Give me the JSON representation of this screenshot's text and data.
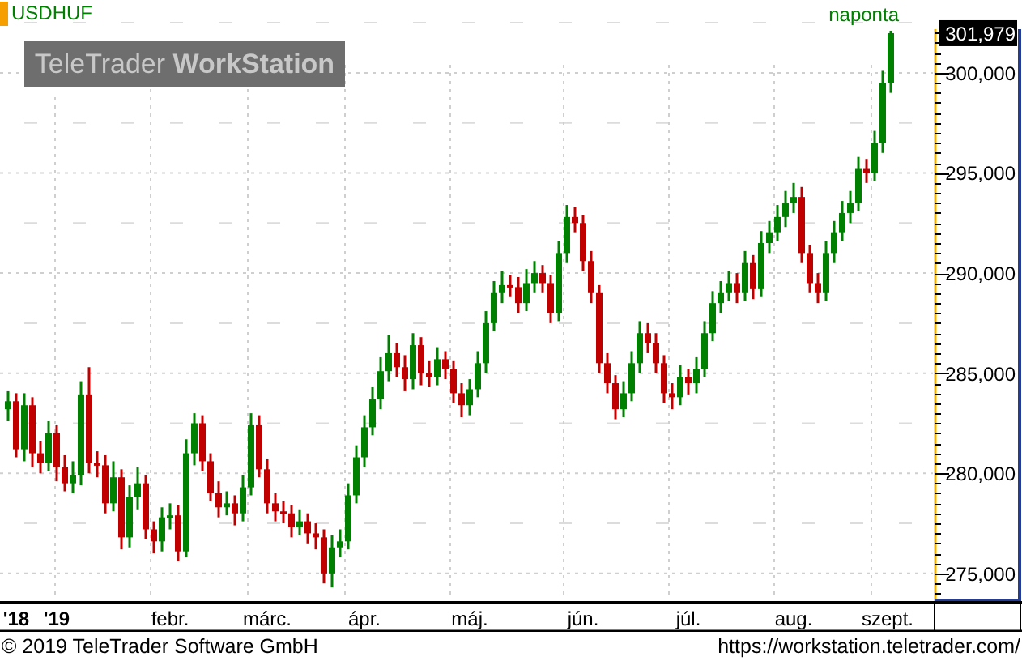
{
  "instrument": {
    "interval": "naponta"
  },
  "branding": {
    "logo": "TeleTrader **WorkStation**"
  },
  "chart": {
    "last_price": "301,979",
    "year_labels": [
      "'18",
      "'19"
    ],
    "chart_data": {
      "type": "candlestick",
      "title": "USDHUF",
      "ylim": [
        273700,
        302180
      ],
      "grid": true,
      "categories": [
        null,
        null,
        null,
        null,
        null,
        null,
        null,
        null,
        null,
        null,
        null,
        null,
        null,
        null,
        null,
        null,
        null,
        null,
        null,
        null,
        "febr.",
        null,
        null,
        null,
        null,
        null,
        null,
        null,
        null,
        null,
        null,
        null,
        "márc.",
        null,
        null,
        null,
        null,
        null,
        null,
        null,
        null,
        null,
        null,
        null,
        "ápr.",
        null,
        null,
        null,
        null,
        null,
        null,
        null,
        null,
        null,
        null,
        null,
        null,
        "máj.",
        null,
        null,
        null,
        null,
        null,
        null,
        null,
        null,
        null,
        null,
        null,
        null,
        null,
        "jún.",
        null,
        null,
        null,
        null,
        null,
        null,
        null,
        null,
        null,
        null,
        null,
        null,
        "júl.",
        null,
        null,
        null,
        null,
        null,
        null,
        null,
        null,
        null,
        null,
        null,
        null,
        "aug.",
        null,
        null,
        null,
        null,
        null,
        null,
        null,
        null,
        null,
        null,
        null,
        "szept."
      ],
      "ohlc": [
        [
          283200,
          284100,
          282600,
          283600
        ],
        [
          283600,
          284000,
          280800,
          281200
        ],
        [
          281200,
          284000,
          280600,
          283400
        ],
        [
          283400,
          283800,
          280300,
          281000
        ],
        [
          281000,
          281600,
          280000,
          280500
        ],
        [
          280500,
          282600,
          280100,
          282000
        ],
        [
          282000,
          282400,
          279600,
          280300
        ],
        [
          280300,
          280900,
          279100,
          279500
        ],
        [
          279500,
          280600,
          279000,
          279900
        ],
        [
          279900,
          284600,
          279400,
          283900
        ],
        [
          283900,
          285300,
          280000,
          280500
        ],
        [
          280500,
          281100,
          279800,
          280400
        ],
        [
          280400,
          280900,
          278000,
          278500
        ],
        [
          278500,
          280600,
          278100,
          279800
        ],
        [
          279800,
          280200,
          276200,
          276800
        ],
        [
          276800,
          279400,
          276300,
          278800
        ],
        [
          278800,
          280300,
          278200,
          279500
        ],
        [
          279500,
          279900,
          276700,
          277200
        ],
        [
          277200,
          277600,
          276000,
          276600
        ],
        [
          276600,
          278300,
          276100,
          277800
        ],
        [
          277800,
          278500,
          277200,
          277900
        ],
        [
          277900,
          278400,
          275600,
          276100
        ],
        [
          276100,
          281700,
          275800,
          281000
        ],
        [
          281000,
          283000,
          280400,
          282500
        ],
        [
          282500,
          282900,
          280100,
          280600
        ],
        [
          280600,
          281000,
          278600,
          279000
        ],
        [
          279000,
          279600,
          277800,
          278300
        ],
        [
          278300,
          279100,
          277900,
          278500
        ],
        [
          278500,
          278900,
          277400,
          278000
        ],
        [
          278000,
          279900,
          277600,
          279300
        ],
        [
          279300,
          283000,
          278900,
          282400
        ],
        [
          282400,
          282900,
          279800,
          280200
        ],
        [
          280200,
          280700,
          278000,
          278500
        ],
        [
          278500,
          279000,
          277600,
          278100
        ],
        [
          278100,
          278600,
          277500,
          278000
        ],
        [
          278000,
          278400,
          276800,
          277300
        ],
        [
          277300,
          278200,
          276900,
          277600
        ],
        [
          277600,
          278000,
          276500,
          277000
        ],
        [
          277000,
          277500,
          276200,
          276800
        ],
        [
          276800,
          277200,
          274500,
          275000
        ],
        [
          275000,
          276900,
          274300,
          276300
        ],
        [
          276300,
          277200,
          275800,
          276600
        ],
        [
          276600,
          279500,
          276200,
          278900
        ],
        [
          278900,
          281400,
          278500,
          280800
        ],
        [
          280800,
          282900,
          280300,
          282300
        ],
        [
          282300,
          284300,
          281900,
          283700
        ],
        [
          283700,
          285800,
          283200,
          285100
        ],
        [
          285100,
          286900,
          284600,
          286000
        ],
        [
          286000,
          286500,
          284800,
          285300
        ],
        [
          285300,
          285900,
          284100,
          284700
        ],
        [
          284700,
          287000,
          284200,
          286400
        ],
        [
          286400,
          286800,
          284400,
          285000
        ],
        [
          285000,
          285600,
          284300,
          284800
        ],
        [
          284800,
          286300,
          284400,
          285700
        ],
        [
          285700,
          286100,
          284700,
          285200
        ],
        [
          285200,
          285600,
          283500,
          284000
        ],
        [
          284000,
          284500,
          282800,
          283400
        ],
        [
          283400,
          284700,
          282900,
          284200
        ],
        [
          284200,
          286100,
          283800,
          285500
        ],
        [
          285500,
          288100,
          285000,
          287500
        ],
        [
          287500,
          289600,
          287100,
          289000
        ],
        [
          289000,
          290100,
          288500,
          289400
        ],
        [
          289400,
          289900,
          288800,
          289300
        ],
        [
          289300,
          289800,
          288000,
          288500
        ],
        [
          288500,
          290200,
          288100,
          289500
        ],
        [
          289500,
          290600,
          289000,
          290000
        ],
        [
          290000,
          290400,
          289000,
          289500
        ],
        [
          289500,
          289900,
          287500,
          288000
        ],
        [
          288000,
          291600,
          287600,
          291000
        ],
        [
          291000,
          293400,
          290500,
          292800
        ],
        [
          292800,
          293300,
          292000,
          292500
        ],
        [
          292500,
          292900,
          290100,
          290600
        ],
        [
          290600,
          291100,
          288500,
          289000
        ],
        [
          289000,
          289400,
          285000,
          285500
        ],
        [
          285500,
          286000,
          284000,
          284500
        ],
        [
          284500,
          284900,
          282700,
          283200
        ],
        [
          283200,
          284600,
          282800,
          284000
        ],
        [
          284000,
          286100,
          283600,
          285500
        ],
        [
          285500,
          287600,
          285000,
          287000
        ],
        [
          287000,
          287500,
          286000,
          286500
        ],
        [
          286500,
          287000,
          285000,
          285500
        ],
        [
          285500,
          285900,
          283500,
          284000
        ],
        [
          284000,
          284500,
          283200,
          283800
        ],
        [
          283800,
          285400,
          283400,
          284800
        ],
        [
          284800,
          285200,
          283900,
          284500
        ],
        [
          284500,
          285800,
          284000,
          285200
        ],
        [
          285200,
          287600,
          284800,
          287000
        ],
        [
          287000,
          289100,
          286600,
          288500
        ],
        [
          288500,
          289600,
          288000,
          289000
        ],
        [
          289000,
          290100,
          288600,
          289500
        ],
        [
          289500,
          290000,
          288500,
          289000
        ],
        [
          289000,
          291100,
          288600,
          290500
        ],
        [
          290500,
          290900,
          288700,
          289200
        ],
        [
          289200,
          292100,
          288800,
          291500
        ],
        [
          291500,
          292600,
          291000,
          292000
        ],
        [
          292000,
          293400,
          291600,
          292800
        ],
        [
          292800,
          294100,
          292300,
          293500
        ],
        [
          293500,
          294500,
          293000,
          293800
        ],
        [
          293800,
          294300,
          290500,
          291000
        ],
        [
          291000,
          291400,
          289000,
          289500
        ],
        [
          289500,
          290000,
          288500,
          289000
        ],
        [
          289000,
          291600,
          288600,
          291000
        ],
        [
          291000,
          292600,
          290500,
          292000
        ],
        [
          292000,
          293600,
          291600,
          293000
        ],
        [
          293000,
          294100,
          292500,
          293500
        ],
        [
          293500,
          295800,
          293100,
          295200
        ],
        [
          295200,
          295700,
          294500,
          295000
        ],
        [
          295000,
          297100,
          294600,
          296500
        ],
        [
          296500,
          300100,
          296000,
          299500
        ],
        [
          299500,
          302100,
          299000,
          301979
        ]
      ],
      "yticks": [
        {
          "value": 275000,
          "label": "275,000"
        },
        {
          "value": 280000,
          "label": "280,000"
        },
        {
          "value": 285000,
          "label": "285,000"
        },
        {
          "value": 290000,
          "label": "290,000"
        },
        {
          "value": 295000,
          "label": "295,000"
        },
        {
          "value": 300000,
          "label": "300,000"
        }
      ]
    }
  },
  "footer": {
    "copyright": "© 2019 TeleTrader Software GmbH",
    "url": "https://workstation.teletrader.com/"
  }
}
